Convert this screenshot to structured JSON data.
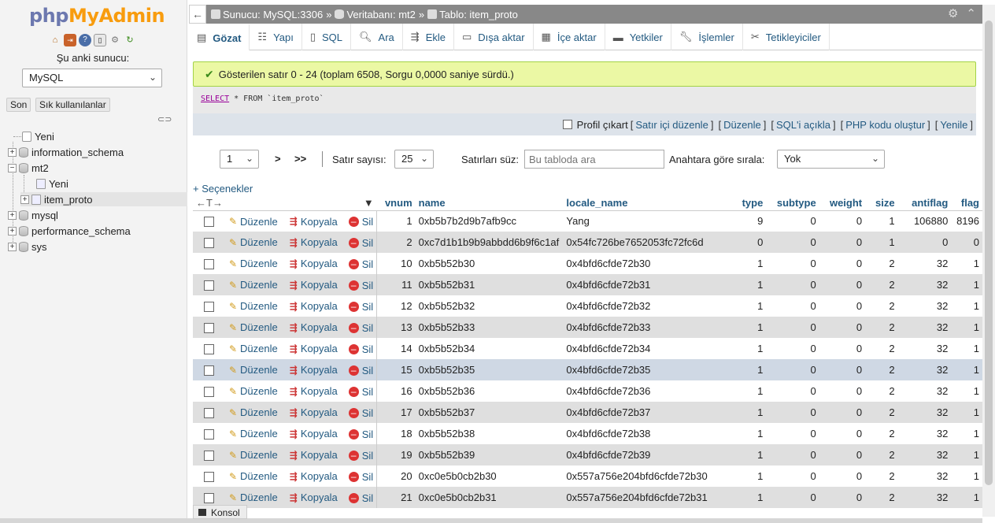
{
  "nav": {
    "logo_php": "php",
    "logo_admin": "MyAdmin",
    "server_label": "Şu anki sunucu:",
    "server_select": "MySQL",
    "recent_btn": "Son",
    "favorites_btn": "Sık kullanılanlar",
    "tree": {
      "new": "Yeni",
      "db1": "information_schema",
      "db2": "mt2",
      "db2_new": "Yeni",
      "db2_table": "item_proto",
      "db3": "mysql",
      "db4": "performance_schema",
      "db5": "sys"
    }
  },
  "breadcrumb": {
    "server": "Sunucu: MySQL:3306",
    "database": "Veritabanı: mt2",
    "table": "Tablo: item_proto"
  },
  "tabs": [
    {
      "label": "Gözat",
      "icon": "browse-icon"
    },
    {
      "label": "Yapı",
      "icon": "structure-icon"
    },
    {
      "label": "SQL",
      "icon": "sql-icon"
    },
    {
      "label": "Ara",
      "icon": "search-icon"
    },
    {
      "label": "Ekle",
      "icon": "insert-icon"
    },
    {
      "label": "Dışa aktar",
      "icon": "export-icon"
    },
    {
      "label": "İçe aktar",
      "icon": "import-icon"
    },
    {
      "label": "Yetkiler",
      "icon": "privileges-icon"
    },
    {
      "label": "İşlemler",
      "icon": "operations-icon"
    },
    {
      "label": "Tetikleyiciler",
      "icon": "triggers-icon"
    }
  ],
  "message": "Gösterilen satır 0 - 24 (toplam 6508, Sorgu 0,0000 saniye sürdü.)",
  "sql": {
    "kw1": "SELECT",
    "mid": " * FROM ",
    "table": "`item_proto`"
  },
  "sql_links": {
    "profile": "Profil çıkart",
    "inline": "Satır içi düzenle",
    "edit": "Düzenle",
    "explain": "SQL'i açıkla",
    "php": "PHP kodu oluştur",
    "refresh": "Yenile"
  },
  "navrow": {
    "page": "1",
    "next": ">",
    "last": ">>",
    "rows_label": "Satır sayısı:",
    "rows_value": "25",
    "filter_label": "Satırları süz:",
    "filter_placeholder": "Bu tabloda ara",
    "sort_label": "Anahtara göre sırala:",
    "sort_value": "Yok"
  },
  "options_label": "+ Seçenekler",
  "actions": {
    "edit": "Düzenle",
    "copy": "Kopyala",
    "delete": "Sil"
  },
  "columns": [
    "vnum",
    "name",
    "locale_name",
    "type",
    "subtype",
    "weight",
    "size",
    "antiflag",
    "flag"
  ],
  "rows": [
    {
      "vnum": "1",
      "name": "0xb5b7b2d9b7afb9cc",
      "locale_name": "Yang",
      "type": "9",
      "subtype": "0",
      "weight": "0",
      "size": "1",
      "antiflag": "106880",
      "flag": "8196"
    },
    {
      "vnum": "2",
      "name": "0xc7d1b1b9b9abbdd6b9f6c1af",
      "locale_name": "0x54fc726be7652053fc72fc6d",
      "type": "0",
      "subtype": "0",
      "weight": "0",
      "size": "1",
      "antiflag": "0",
      "flag": "0"
    },
    {
      "vnum": "10",
      "name": "0xb5b52b30",
      "locale_name": "0x4bfd6cfde72b30",
      "type": "1",
      "subtype": "0",
      "weight": "0",
      "size": "2",
      "antiflag": "32",
      "flag": "1"
    },
    {
      "vnum": "11",
      "name": "0xb5b52b31",
      "locale_name": "0x4bfd6cfde72b31",
      "type": "1",
      "subtype": "0",
      "weight": "0",
      "size": "2",
      "antiflag": "32",
      "flag": "1"
    },
    {
      "vnum": "12",
      "name": "0xb5b52b32",
      "locale_name": "0x4bfd6cfde72b32",
      "type": "1",
      "subtype": "0",
      "weight": "0",
      "size": "2",
      "antiflag": "32",
      "flag": "1"
    },
    {
      "vnum": "13",
      "name": "0xb5b52b33",
      "locale_name": "0x4bfd6cfde72b33",
      "type": "1",
      "subtype": "0",
      "weight": "0",
      "size": "2",
      "antiflag": "32",
      "flag": "1"
    },
    {
      "vnum": "14",
      "name": "0xb5b52b34",
      "locale_name": "0x4bfd6cfde72b34",
      "type": "1",
      "subtype": "0",
      "weight": "0",
      "size": "2",
      "antiflag": "32",
      "flag": "1"
    },
    {
      "vnum": "15",
      "name": "0xb5b52b35",
      "locale_name": "0x4bfd6cfde72b35",
      "type": "1",
      "subtype": "0",
      "weight": "0",
      "size": "2",
      "antiflag": "32",
      "flag": "1"
    },
    {
      "vnum": "16",
      "name": "0xb5b52b36",
      "locale_name": "0x4bfd6cfde72b36",
      "type": "1",
      "subtype": "0",
      "weight": "0",
      "size": "2",
      "antiflag": "32",
      "flag": "1"
    },
    {
      "vnum": "17",
      "name": "0xb5b52b37",
      "locale_name": "0x4bfd6cfde72b37",
      "type": "1",
      "subtype": "0",
      "weight": "0",
      "size": "2",
      "antiflag": "32",
      "flag": "1"
    },
    {
      "vnum": "18",
      "name": "0xb5b52b38",
      "locale_name": "0x4bfd6cfde72b38",
      "type": "1",
      "subtype": "0",
      "weight": "0",
      "size": "2",
      "antiflag": "32",
      "flag": "1"
    },
    {
      "vnum": "19",
      "name": "0xb5b52b39",
      "locale_name": "0x4bfd6cfde72b39",
      "type": "1",
      "subtype": "0",
      "weight": "0",
      "size": "2",
      "antiflag": "32",
      "flag": "1"
    },
    {
      "vnum": "20",
      "name": "0xc0e5b0cb2b30",
      "locale_name": "0x557a756e204bfd6cfde72b30",
      "type": "1",
      "subtype": "0",
      "weight": "0",
      "size": "2",
      "antiflag": "32",
      "flag": "1"
    },
    {
      "vnum": "21",
      "name": "0xc0e5b0cb2b31",
      "locale_name": "0x557a756e204bfd6cfde72b31",
      "type": "1",
      "subtype": "0",
      "weight": "0",
      "size": "2",
      "antiflag": "32",
      "flag": "1"
    }
  ],
  "highlighted_vnum": "15",
  "console_label": "Konsol",
  "colors": {
    "accent": "#235a81",
    "success_bg": "#ebf8a4",
    "topbar": "#888888",
    "highlight_row": "#cfd8e4"
  }
}
